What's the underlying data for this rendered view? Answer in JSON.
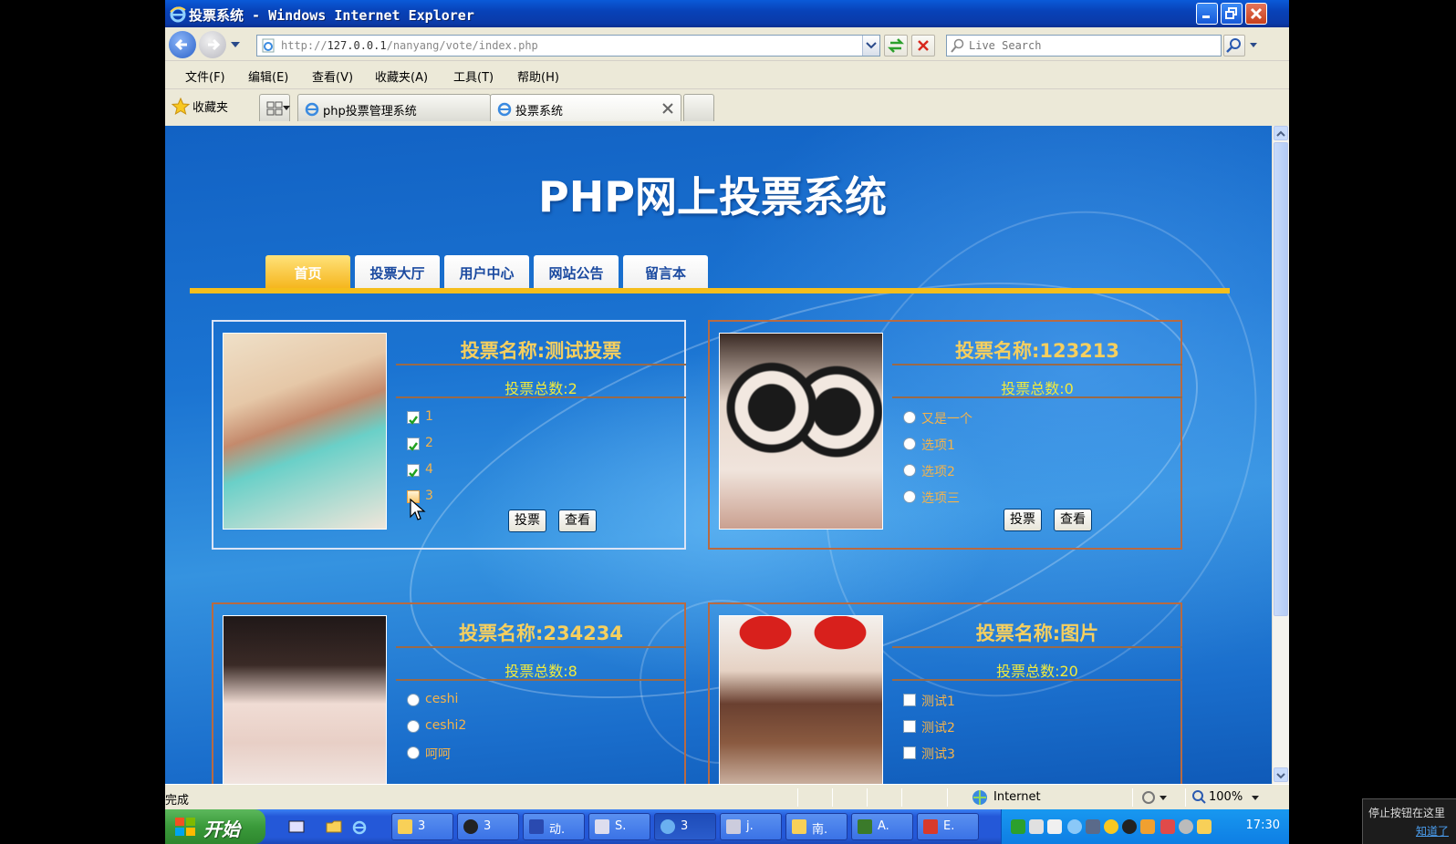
{
  "window": {
    "title": "投票系统 - Windows Internet Explorer"
  },
  "address": {
    "url_prefix": "http://",
    "url_host": "127.0.0.1",
    "url_path": "/nanyang/vote/index.php",
    "search_placeholder": "Live Search"
  },
  "menu": [
    "文件(F)",
    "编辑(E)",
    "查看(V)",
    "收藏夹(A)",
    "工具(T)",
    "帮助(H)"
  ],
  "favorites_label": "收藏夹",
  "tabs": [
    {
      "label": "php投票管理系统"
    },
    {
      "label": "投票系统"
    }
  ],
  "site": {
    "title": "PHP网上投票系统",
    "nav": [
      "首页",
      "投票大厅",
      "用户中心",
      "网站公告",
      "留言本"
    ]
  },
  "polls": [
    {
      "name": "投票名称:测试投票",
      "count": "投票总数:2",
      "type": "checkbox",
      "options": [
        {
          "label": "1",
          "checked": true
        },
        {
          "label": "2",
          "checked": true
        },
        {
          "label": "4",
          "checked": true
        },
        {
          "label": "3",
          "checked": false
        }
      ],
      "vote_label": "投票",
      "view_label": "查看"
    },
    {
      "name": "投票名称:123213",
      "count": "投票总数:0",
      "type": "radio",
      "options": [
        {
          "label": "又是一个",
          "checked": false
        },
        {
          "label": "选项1",
          "checked": false
        },
        {
          "label": "选项2",
          "checked": false
        },
        {
          "label": "选项三",
          "checked": false
        }
      ],
      "vote_label": "投票",
      "view_label": "查看"
    },
    {
      "name": "投票名称:234234",
      "count": "投票总数:8",
      "type": "radio",
      "options": [
        {
          "label": "ceshi",
          "checked": false
        },
        {
          "label": "ceshi2",
          "checked": false
        },
        {
          "label": "呵呵",
          "checked": false
        }
      ]
    },
    {
      "name": "投票名称:图片",
      "count": "投票总数:20",
      "type": "checkbox",
      "options": [
        {
          "label": "测试1",
          "checked": false
        },
        {
          "label": "测试2",
          "checked": false
        },
        {
          "label": "测试3",
          "checked": false
        }
      ]
    }
  ],
  "status": {
    "text": "完成",
    "zone": "Internet",
    "zoom": "100%"
  },
  "taskbar": {
    "start": "开始",
    "tasks": [
      "3",
      "3",
      "动.",
      "S.",
      "3",
      "j.",
      "南.",
      "A.",
      "E."
    ],
    "clock": "17:30"
  },
  "notification": {
    "line1": "停止按钮在这里",
    "link": "知道了"
  },
  "colors": {
    "accent_gold": "#f5be1c",
    "poll_title": "#f5cf5f",
    "poll_count": "#f2ea3c",
    "option_text": "#f5b34a"
  }
}
